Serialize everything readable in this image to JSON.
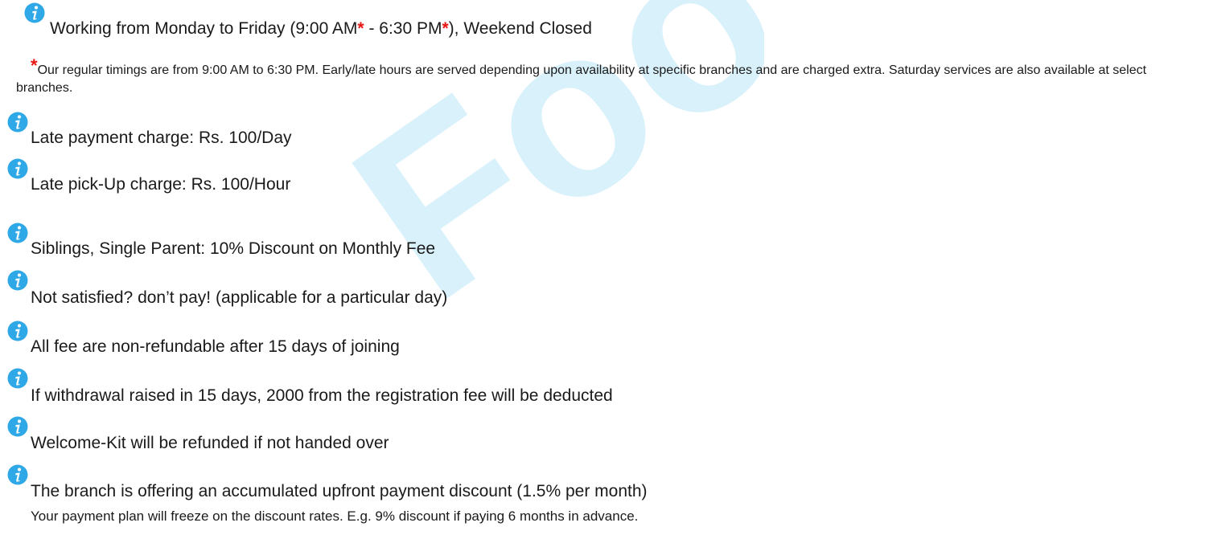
{
  "watermark": {
    "text": "Foot"
  },
  "colors": {
    "accent_red": "#e8140f",
    "icon_blue": "#2ea8e6",
    "watermark": "#d9f1fb"
  },
  "icon": "info-icon",
  "hours": {
    "prefix": "Working from Monday to Friday (9:00 AM",
    "star1": "*",
    "middle": " - 6:30 PM",
    "star2": "*",
    "suffix": "), Weekend Closed"
  },
  "note": {
    "star": "*",
    "text": "Our regular timings are from 9:00 AM to 6:30 PM. Early/late hours are served depending upon availability at specific branches and are charged extra. Saturday services are also available at select branches."
  },
  "items": [
    "Late payment charge: Rs. 100/Day",
    "Late pick-Up charge: Rs. 100/Hour",
    "Siblings, Single Parent: 10% Discount on Monthly Fee",
    "Not satisfied? don’t pay! (applicable for a particular day)",
    "All fee are non-refundable after 15 days of joining",
    "If withdrawal raised in 15 days, 2000 from the registration fee will be deducted",
    "Welcome-Kit will be refunded if not handed over",
    "The branch is offering an accumulated upfront payment discount (1.5% per month)"
  ],
  "subnote": "Your payment plan will freeze on the discount rates. E.g. 9% discount if paying 6 months in advance."
}
